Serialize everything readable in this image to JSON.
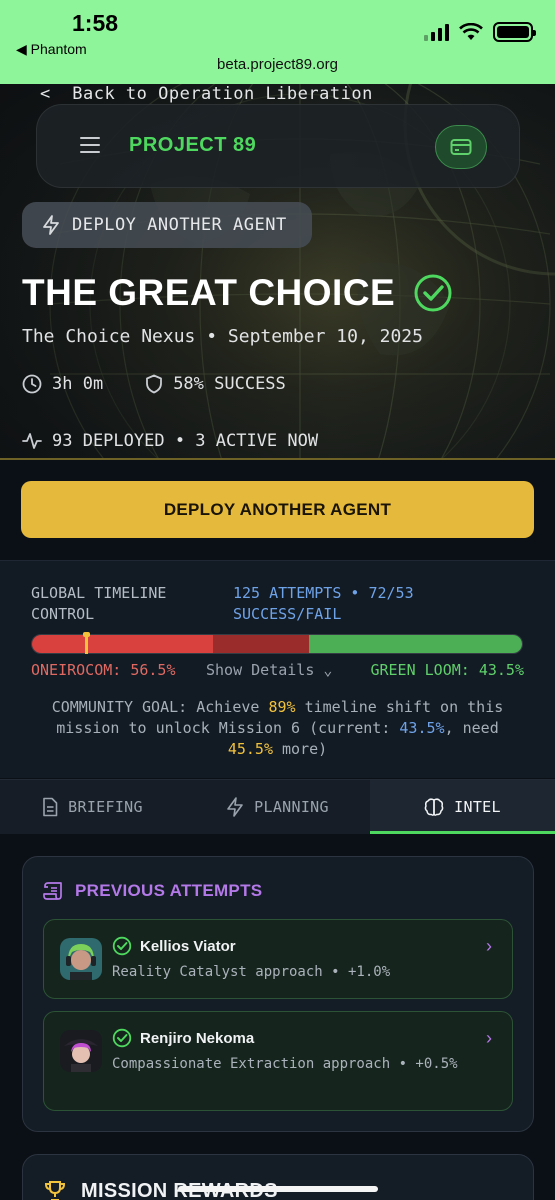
{
  "status_bar": {
    "time": "1:58",
    "back_app": "◀ Phantom",
    "url": "beta.project89.org"
  },
  "hero": {
    "back_link": "Back to Operation Liberation",
    "brand": "PROJECT 89",
    "deploy_pill": "DEPLOY ANOTHER AGENT",
    "title": "THE GREAT CHOICE",
    "subtitle": "The Choice Nexus • September 10, 2025",
    "duration": "3h 0m",
    "success_rate": "58% SUCCESS",
    "deployed": "93 DEPLOYED • 3 ACTIVE NOW"
  },
  "deploy_button": "DEPLOY ANOTHER AGENT",
  "timeline": {
    "label": "GLOBAL TIMELINE CONTROL",
    "attempts": "125 ATTEMPTS • 72/53 SUCCESS/FAIL",
    "left_faction": "ONEIROCOM: 56.5%",
    "show_details": "Show Details",
    "right_faction": "GREEN LOOM: 43.5%",
    "bar_red_fraction": 0.37,
    "bar_darkred_fraction": 0.195,
    "bar_green_fraction": 0.435,
    "marker_fraction": 0.11,
    "goal": {
      "part1": "COMMUNITY GOAL: Achieve ",
      "target": "89%",
      "part2": " timeline shift on this mission to unlock Mission 6 (current: ",
      "current": "43.5%",
      "part3": ", need ",
      "need": "45.5%",
      "part4": " more)"
    }
  },
  "tabs": [
    {
      "label": "BRIEFING",
      "icon": "document-icon",
      "active": false
    },
    {
      "label": "PLANNING",
      "icon": "bolt-icon",
      "active": false
    },
    {
      "label": "INTEL",
      "icon": "brain-icon",
      "active": true
    }
  ],
  "intel": {
    "heading": "PREVIOUS ATTEMPTS",
    "attempts": [
      {
        "name": "Kellios Viator",
        "description": "Reality Catalyst approach • +1.0%"
      },
      {
        "name": "Renjiro Nekoma",
        "description": "Compassionate Extraction approach • +0.5%"
      }
    ]
  },
  "rewards": {
    "heading": "MISSION REWARDS"
  },
  "colors": {
    "accent_green": "#4ed85f",
    "deploy_gold": "#e5b93b",
    "oneirocom_red": "#d8413d",
    "intel_purple": "#b479e8"
  }
}
